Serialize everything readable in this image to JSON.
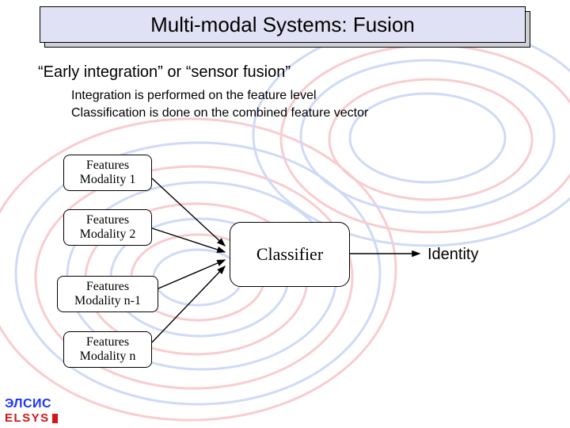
{
  "title": "Multi-modal Systems: Fusion",
  "lead": "“Early integration” or “sensor fusion”",
  "bullets": {
    "b1": "Integration is performed on the feature level",
    "b2": "Classification is done on the combined feature vector"
  },
  "boxes": {
    "m1a": "Features",
    "m1b": "Modality 1",
    "m2a": "Features",
    "m2b": "Modality 2",
    "m3a": "Features",
    "m3b": "Modality n-1",
    "m4a": "Features",
    "m4b": "Modality n",
    "classifier": "Classifier",
    "identity": "Identity"
  },
  "logo": {
    "ru": "ЭЛСИС",
    "en": "ELSYS"
  }
}
